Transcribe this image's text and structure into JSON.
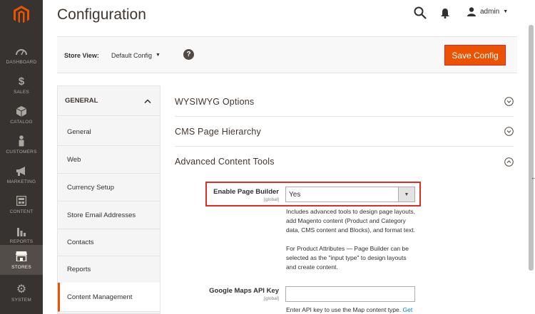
{
  "nav": {
    "items": [
      {
        "label": "DASHBOARD",
        "icon": "dashboard-icon"
      },
      {
        "label": "SALES",
        "icon": "dollar-icon"
      },
      {
        "label": "CATALOG",
        "icon": "catalog-cube-icon"
      },
      {
        "label": "CUSTOMERS",
        "icon": "customer-person-icon"
      },
      {
        "label": "MARKETING",
        "icon": "megaphone-icon"
      },
      {
        "label": "CONTENT",
        "icon": "content-layout-icon"
      },
      {
        "label": "REPORTS",
        "icon": "bar-chart-icon"
      },
      {
        "label": "STORES",
        "icon": "storefront-icon"
      },
      {
        "label": "SYSTEM",
        "icon": "gear-icon"
      }
    ],
    "active": "STORES"
  },
  "header": {
    "title": "Configuration",
    "user": "admin"
  },
  "scope": {
    "label": "Store View:",
    "value": "Default Config",
    "save_label": "Save Config",
    "help": "?"
  },
  "tabs": {
    "group": "GENERAL",
    "items": [
      "General",
      "Web",
      "Currency Setup",
      "Store Email Addresses",
      "Contacts",
      "Reports",
      "Content Management"
    ],
    "active": "Content Management"
  },
  "sections": [
    {
      "title": "WYSIWYG Options",
      "state": "collapsed"
    },
    {
      "title": "CMS Page Hierarchy",
      "state": "collapsed"
    },
    {
      "title": "Advanced Content Tools",
      "state": "expanded"
    }
  ],
  "fields": {
    "page_builder": {
      "label": "Enable Page Builder",
      "scope": "[global]",
      "value": "Yes",
      "note1": [
        "Includes advanced tools to design page layouts,",
        "add Magento content (Product and Category",
        "data, CMS content and Blocks), and format text."
      ],
      "note2": [
        "For Product Attributes — Page Builder can be",
        "selected as the \"input type\" to design layouts",
        "and create content."
      ]
    },
    "maps_key": {
      "label": "Google Maps API Key",
      "scope": "[global]",
      "value": "",
      "note": "Enter API key to use the Map content type.",
      "link": "Get"
    }
  },
  "colors": {
    "accent": "#eb5202",
    "nav_bg": "#373330",
    "highlight": "#e02b27"
  }
}
